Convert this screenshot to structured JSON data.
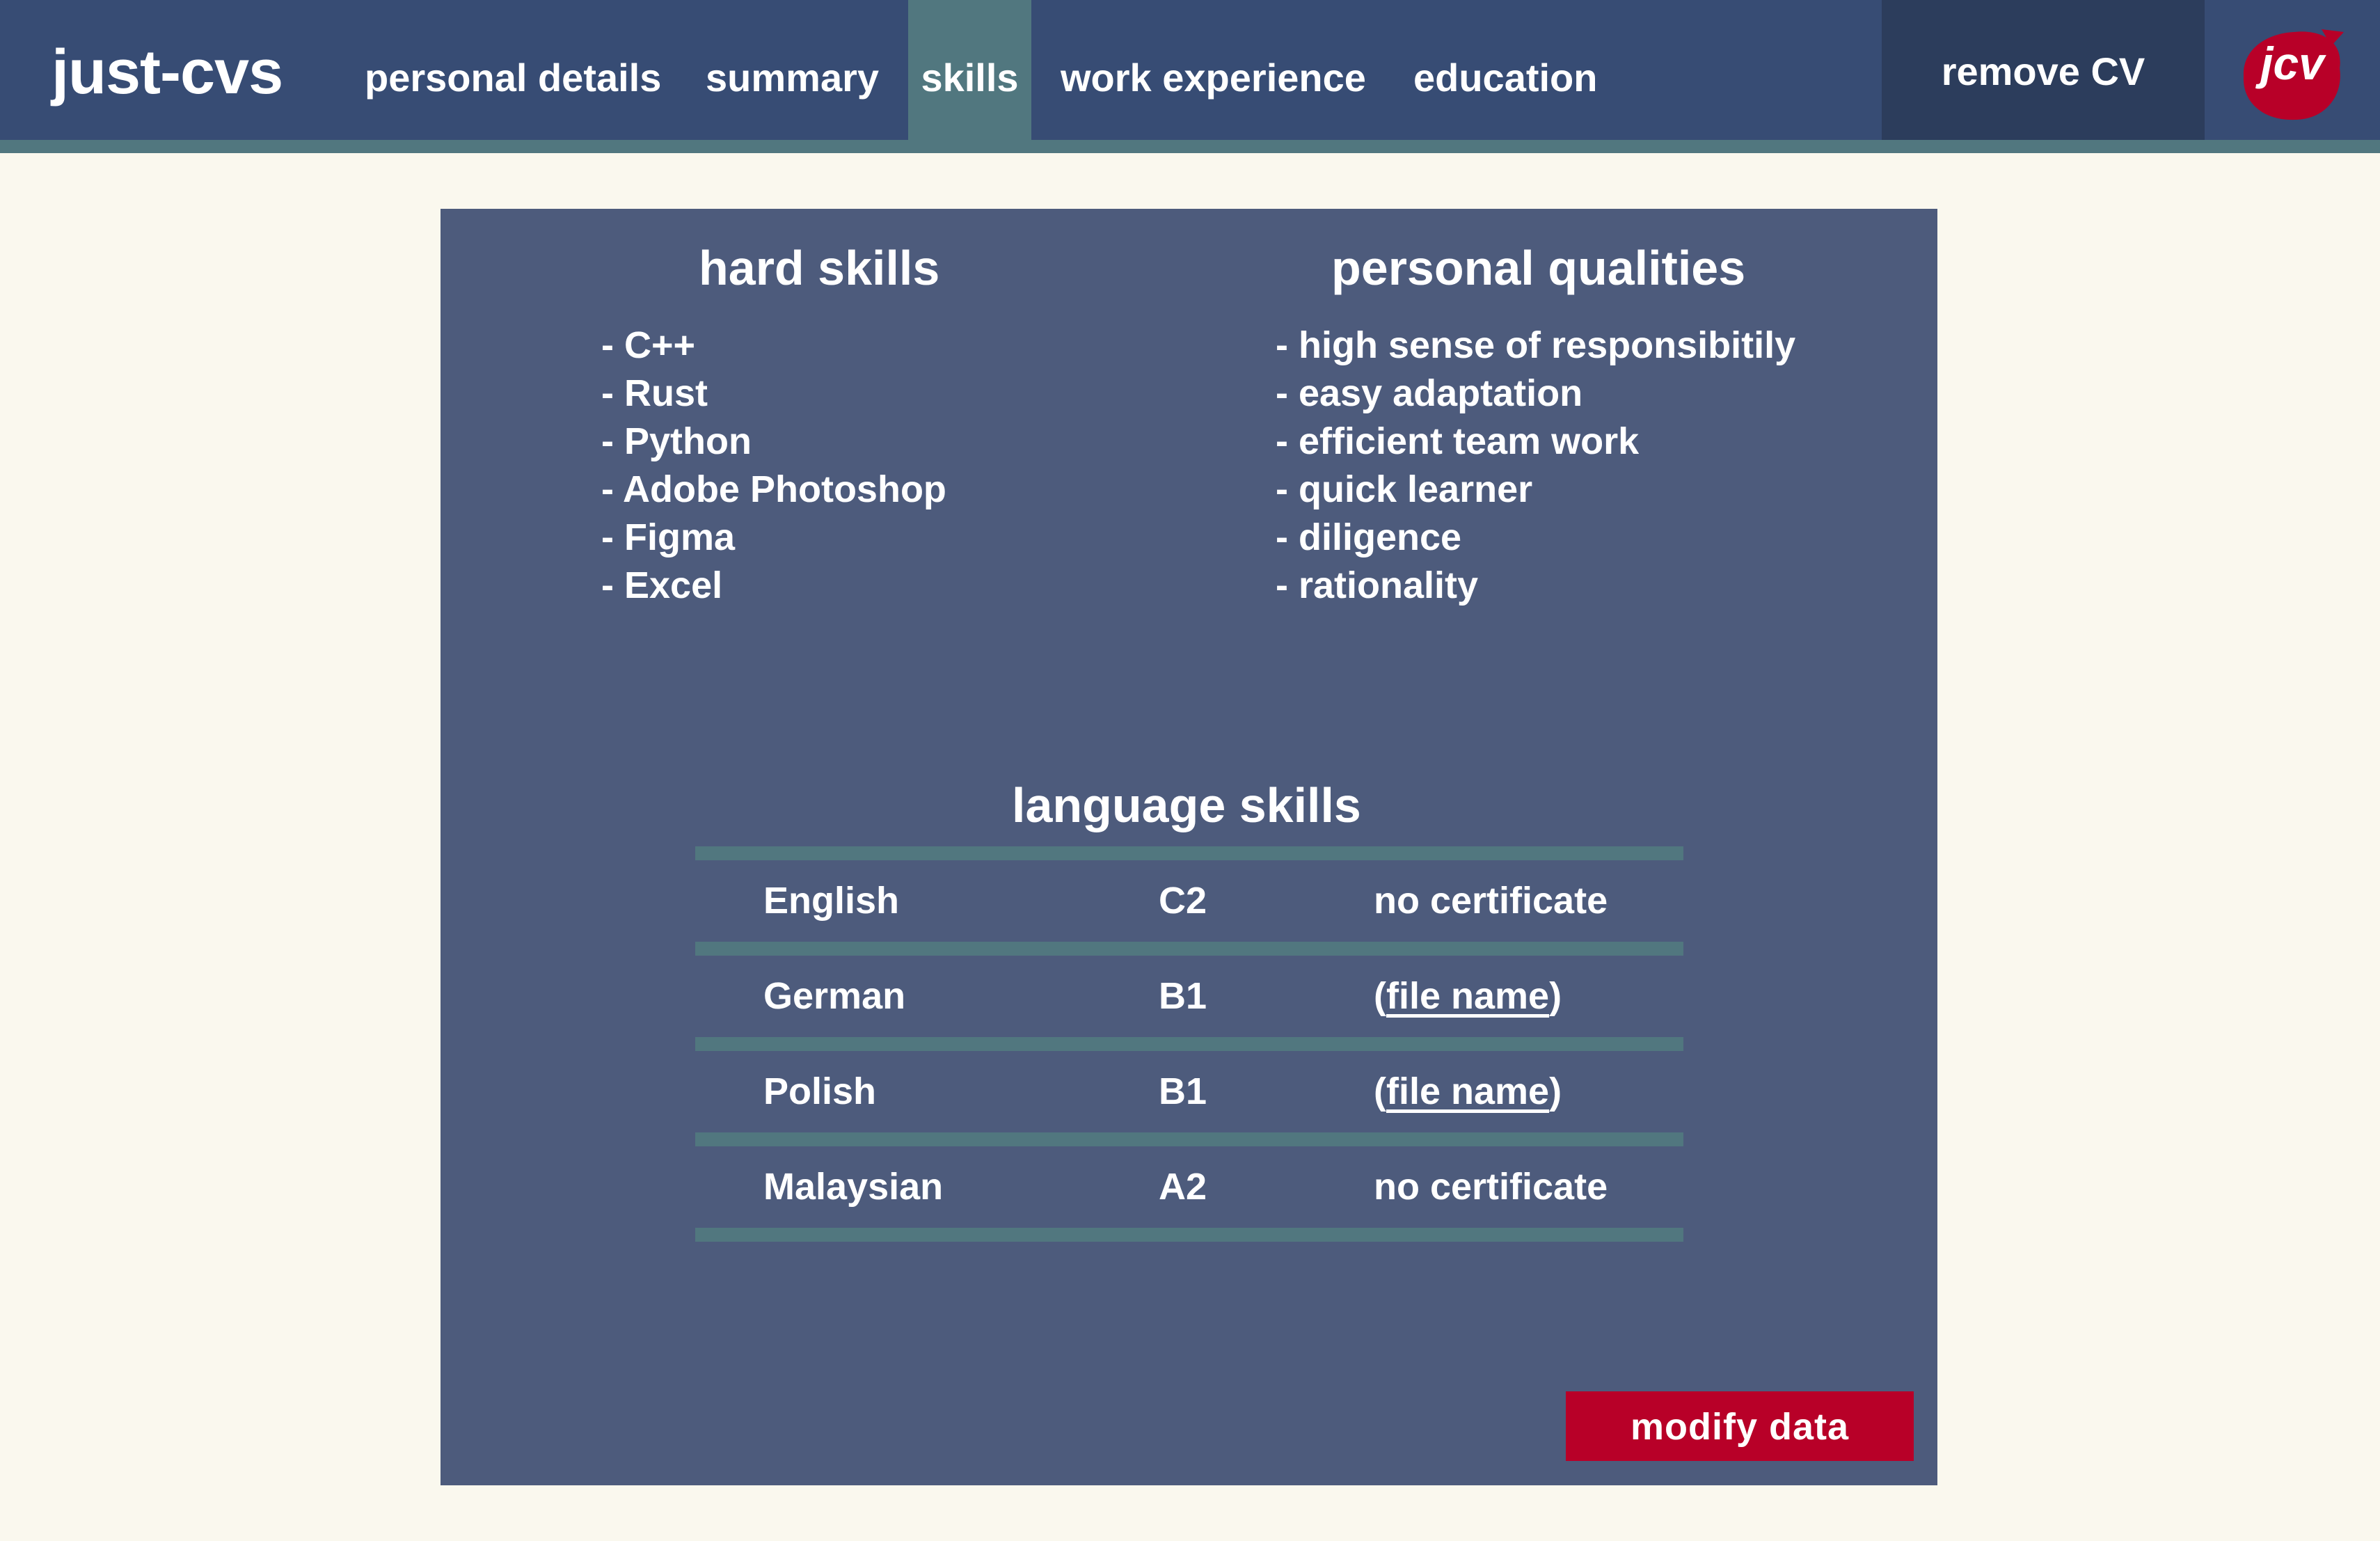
{
  "app": {
    "brand": "just-cvs",
    "logo_text": "jcv",
    "remove_label": "remove CV"
  },
  "nav": {
    "items": [
      {
        "label": "personal details"
      },
      {
        "label": "summary"
      },
      {
        "label": "skills",
        "active": true
      },
      {
        "label": "work experience"
      },
      {
        "label": "education"
      }
    ]
  },
  "skills": {
    "hard_title": "hard skills",
    "hard": [
      "- C++",
      "- Rust",
      "- Python",
      "- Adobe Photoshop",
      "- Figma",
      "- Excel"
    ],
    "personal_title": "personal qualities",
    "personal": [
      "- high sense of responsibitily",
      "- easy adaptation",
      "- efficient team work",
      "- quick learner",
      "- diligence",
      "- rationality"
    ]
  },
  "languages": {
    "title": "language skills",
    "rows": [
      {
        "language": "English",
        "level": "C2",
        "certificate": "no certificate",
        "is_file": false
      },
      {
        "language": "German",
        "level": "B1",
        "certificate": "file name",
        "is_file": true
      },
      {
        "language": "Polish",
        "level": "B1",
        "certificate": "file name",
        "is_file": true
      },
      {
        "language": "Malaysian",
        "level": "A2",
        "certificate": "no certificate",
        "is_file": false
      }
    ]
  },
  "actions": {
    "modify_label": "modify data"
  },
  "colors": {
    "background": "#faf8ee",
    "topbar": "#374c74",
    "accent": "#51777f",
    "panel": "#4d5b7c",
    "remove_bg": "#2c3d5c",
    "brand_red": "#b80028"
  }
}
